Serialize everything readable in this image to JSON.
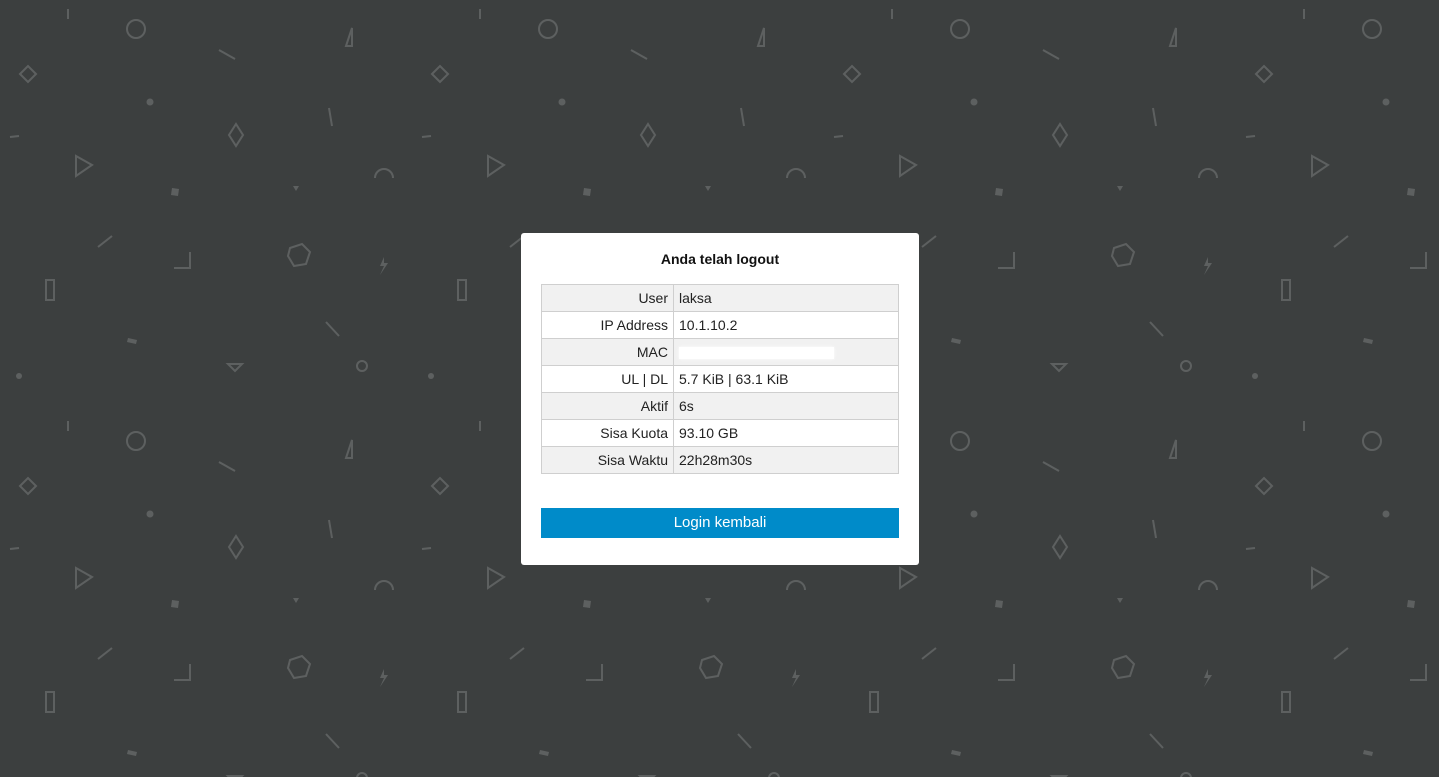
{
  "title": "Anda telah logout",
  "rows": [
    {
      "label": "User",
      "value": "laksa"
    },
    {
      "label": "IP Address",
      "value": "10.1.10.2"
    },
    {
      "label": "MAC",
      "value": ""
    },
    {
      "label": "UL | DL",
      "value": "5.7 KiB | 63.1 KiB"
    },
    {
      "label": "Aktif",
      "value": "6s"
    },
    {
      "label": "Sisa Kuota",
      "value": "93.10 GB"
    },
    {
      "label": "Sisa Waktu",
      "value": "22h28m30s"
    }
  ],
  "login_button": "Login kembali",
  "colors": {
    "background": "#3c3f3f",
    "pattern": "#5d6060",
    "button": "#008bc9"
  },
  "background_pattern_icons": [
    "circle-icon",
    "triangle-icon",
    "diamond-icon",
    "hexagon-icon",
    "lightning-icon",
    "rectangle-icon",
    "arc-icon",
    "line-icon",
    "dot-icon"
  ]
}
